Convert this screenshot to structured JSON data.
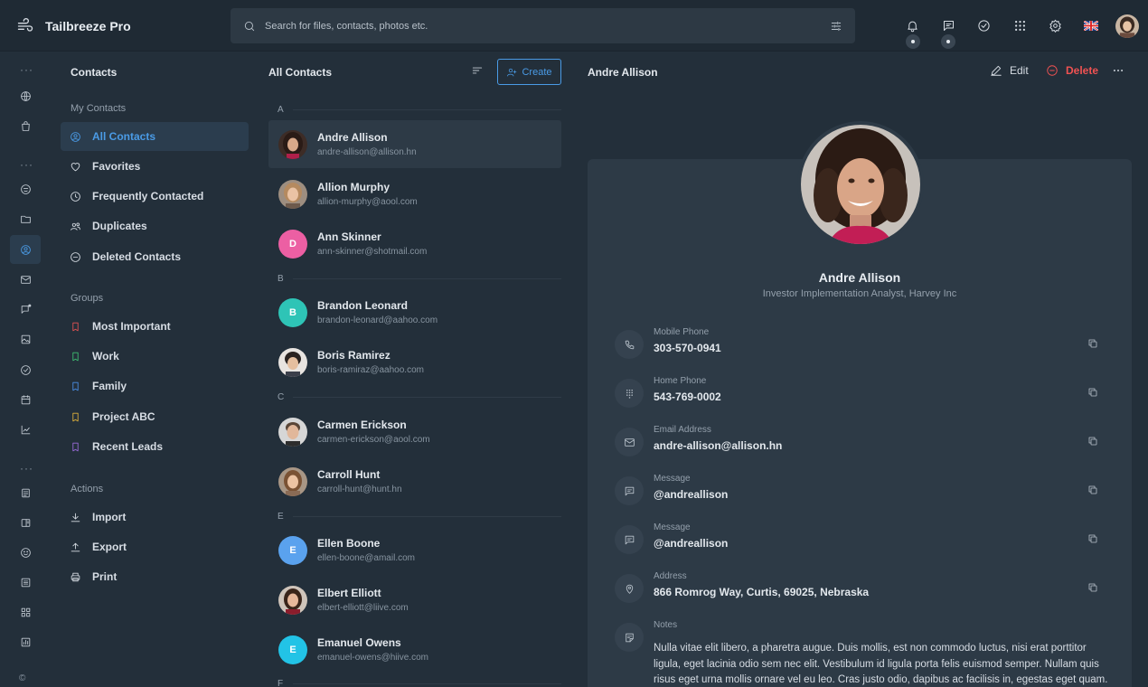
{
  "app": {
    "name": "Tailbreeze Pro"
  },
  "search": {
    "placeholder": "Search for files, contacts, photos etc."
  },
  "nav": {
    "title": "Contacts",
    "my_contacts_label": "My Contacts",
    "items": [
      {
        "label": "All Contacts",
        "icon": "user-circle-icon"
      },
      {
        "label": "Favorites",
        "icon": "heart-icon"
      },
      {
        "label": "Frequently Contacted",
        "icon": "clock-icon"
      },
      {
        "label": "Duplicates",
        "icon": "users-icon"
      },
      {
        "label": "Deleted Contacts",
        "icon": "minus-circle-icon"
      }
    ],
    "groups_label": "Groups",
    "groups": [
      {
        "label": "Most Important",
        "color": "#e55353"
      },
      {
        "label": "Work",
        "color": "#3fbf72"
      },
      {
        "label": "Family",
        "color": "#4a8fe6"
      },
      {
        "label": "Project ABC",
        "color": "#e0b23a"
      },
      {
        "label": "Recent Leads",
        "color": "#9b6cdb"
      }
    ],
    "actions_label": "Actions",
    "actions": [
      {
        "label": "Import",
        "icon": "download-icon"
      },
      {
        "label": "Export",
        "icon": "upload-icon"
      },
      {
        "label": "Print",
        "icon": "printer-icon"
      }
    ]
  },
  "list": {
    "title": "All Contacts",
    "create_label": "Create",
    "letters": [
      "A",
      "B",
      "C",
      "E",
      "F"
    ],
    "contacts": [
      {
        "name": "Andre Allison",
        "email": "andre-allison@allison.hn",
        "avatar": "photo"
      },
      {
        "name": "Allion Murphy",
        "email": "allion-murphy@aool.com",
        "avatar": "photo"
      },
      {
        "name": "Ann Skinner",
        "email": "ann-skinner@shotmail.com",
        "initial": "D",
        "color": "#ec5fa3"
      },
      {
        "name": "Brandon Leonard",
        "email": "brandon-leonard@aahoo.com",
        "initial": "B",
        "color": "#2ec4b6"
      },
      {
        "name": "Boris Ramirez",
        "email": "boris-ramiraz@aahoo.com",
        "avatar": "photo"
      },
      {
        "name": "Carmen Erickson",
        "email": "carmen-erickson@aool.com",
        "avatar": "photo"
      },
      {
        "name": "Carroll Hunt",
        "email": "carroll-hunt@hunt.hn",
        "avatar": "photo"
      },
      {
        "name": "Ellen Boone",
        "email": "ellen-boone@amail.com",
        "initial": "E",
        "color": "#5aa2ee"
      },
      {
        "name": "Elbert Elliott",
        "email": "elbert-elliott@liive.com",
        "avatar": "photo"
      },
      {
        "name": "Emanuel Owens",
        "email": "emanuel-owens@hiive.com",
        "initial": "E",
        "color": "#22c3e6"
      }
    ]
  },
  "detail": {
    "title": "Andre Allison",
    "edit_label": "Edit",
    "delete_label": "Delete",
    "name": "Andre Allison",
    "subtitle": "Investor Implementation Analyst, Harvey Inc",
    "fields": [
      {
        "label": "Mobile Phone",
        "value": "303-570-0941",
        "icon": "phone-icon"
      },
      {
        "label": "Home Phone",
        "value": "543-769-0002",
        "icon": "dialpad-icon"
      },
      {
        "label": "Email Address",
        "value": "andre-allison@allison.hn",
        "icon": "mail-icon"
      },
      {
        "label": "Message",
        "value": "@andreallison",
        "icon": "message-icon"
      },
      {
        "label": "Message",
        "value": "@andreallison",
        "icon": "message-icon"
      },
      {
        "label": "Address",
        "value": "866 Romrog Way, Curtis, 69025, Nebraska",
        "icon": "map-pin-icon"
      }
    ],
    "notes_label": "Notes",
    "notes": "Nulla vitae elit libero, a pharetra augue. Duis mollis, est non commodo luctus, nisi erat porttitor ligula, eget lacinia odio sem nec elit. Vestibulum id ligula porta felis euismod semper. Nullam quis risus eget urna mollis ornare vel eu leo. Cras justo odio, dapibus ac facilisis in, egestas eget quam. Donec ullamcorper nulla non metus auctor fringilla."
  },
  "rail": {
    "copyright": "©"
  },
  "colors": {
    "accent": "#4a9be6",
    "danger": "#f05252",
    "background": "#232f3a",
    "card": "#2d3a46"
  }
}
